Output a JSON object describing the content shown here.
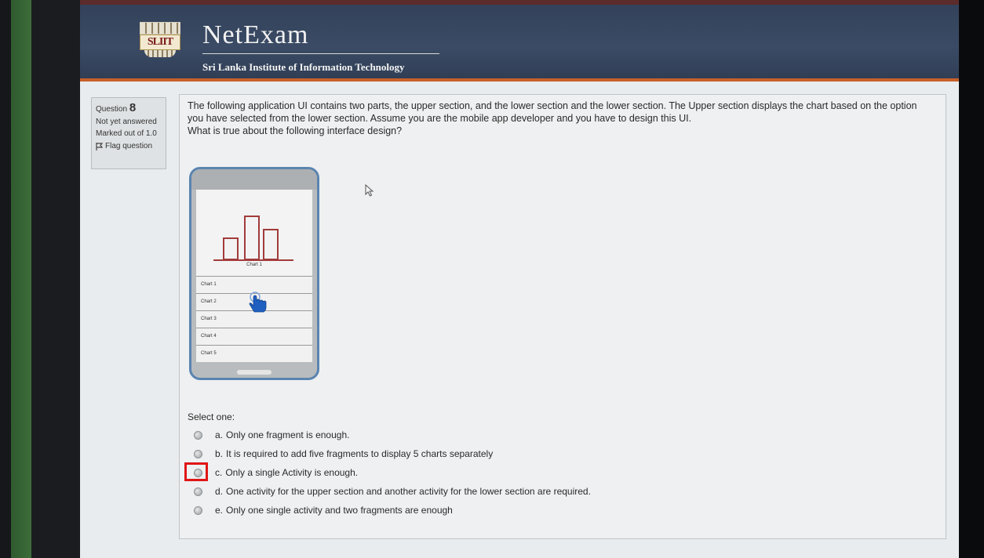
{
  "header": {
    "logo_text": "SLIIT",
    "app_name": "NetExam",
    "subtitle": "Sri Lanka Institute of Information Technology"
  },
  "question_info": {
    "label": "Question",
    "number": "8",
    "status": "Not yet answered",
    "marks": "Marked out of 1.0",
    "flag_label": "Flag question"
  },
  "question": {
    "text_1": "The following application UI contains two parts, the upper section, and the lower section and the lower section. The Upper section displays the chart based on the option you have selected from the lower section. Assume you are the mobile app developer and you have to design this UI.",
    "text_2": "What is true about the following interface design?"
  },
  "mockup": {
    "chart_caption": "Chart 1",
    "items": [
      "Chart 1",
      "Chart 2",
      "Chart 3",
      "Chart 4",
      "Chart 5"
    ],
    "accent_color": "#a23b3b",
    "frame_color": "#5a84b0",
    "icon": "pointing-hand-icon"
  },
  "answers": {
    "prompt": "Select one:",
    "options": [
      {
        "letter": "a.",
        "text": "Only one fragment is enough."
      },
      {
        "letter": "b.",
        "text": "It is required to add five fragments to display 5 charts separately"
      },
      {
        "letter": "c.",
        "text": "Only a single Activity is enough."
      },
      {
        "letter": "d.",
        "text": "One activity for the upper section and another activity for the lower section are required."
      },
      {
        "letter": "e.",
        "text": "Only one single activity and two fragments are enough"
      }
    ],
    "highlighted_option": "c.",
    "highlight_color": "#e01515"
  }
}
